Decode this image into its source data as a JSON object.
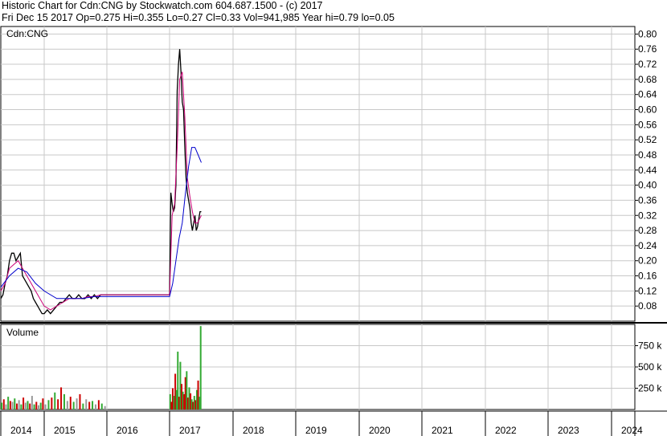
{
  "header": {
    "line1": "Historic Chart for Cdn:CNG by Stockwatch.com 604.687.1500 - (c) 2017",
    "line2": "Fri Dec 15 2017   Op=0.275   Hi=0.355   Lo=0.27   Cl=0.33   Vol=941,985   Year hi=0.79   lo=0.05"
  },
  "chart_data": [
    {
      "type": "line",
      "subtype": "ohlc-price",
      "label": "Cdn:CNG",
      "ylim": [
        0.04,
        0.82
      ],
      "y_ticks": [
        0.08,
        0.12,
        0.16,
        0.2,
        0.24,
        0.28,
        0.32,
        0.36,
        0.4,
        0.44,
        0.48,
        0.52,
        0.56,
        0.6,
        0.64,
        0.68,
        0.72,
        0.76,
        0.8
      ],
      "y_tick_labels": [
        "0.08",
        "0.12",
        "0.16",
        "0.20",
        "0.24",
        "0.28",
        "0.32",
        "0.36",
        "0.40",
        "0.44",
        "0.48",
        "0.52",
        "0.56",
        "0.60",
        "0.64",
        "0.68",
        "0.72",
        "0.76",
        "0.80"
      ],
      "x_years": [
        "2014",
        "2015",
        "2016",
        "2017",
        "2018",
        "2019",
        "2020",
        "2021",
        "2022",
        "2023",
        "2024"
      ],
      "grid": true,
      "series": [
        {
          "role": "price",
          "color": "#000000",
          "x": [
            2014.0,
            2014.05,
            2014.1,
            2014.15,
            2014.2,
            2014.25,
            2014.3,
            2014.35,
            2014.4,
            2014.45,
            2014.5,
            2014.55,
            2014.6,
            2014.65,
            2014.7,
            2014.75,
            2014.8,
            2014.85,
            2014.9,
            2014.95,
            2015.0,
            2015.05,
            2015.1,
            2015.15,
            2015.2,
            2015.25,
            2015.3,
            2015.35,
            2015.4,
            2015.45,
            2015.5,
            2015.55,
            2015.6,
            2015.65,
            2015.7,
            2015.75,
            2015.8,
            2015.85,
            2015.9,
            2015.95,
            2016.0,
            2017.0,
            2017.02,
            2017.04,
            2017.06,
            2017.08,
            2017.1,
            2017.12,
            2017.14,
            2017.16,
            2017.18,
            2017.2,
            2017.22,
            2017.24,
            2017.26,
            2017.28,
            2017.3,
            2017.32,
            2017.34,
            2017.36,
            2017.38,
            2017.4,
            2017.42,
            2017.44,
            2017.46,
            2017.48,
            2017.5
          ],
          "y": [
            0.1,
            0.11,
            0.14,
            0.16,
            0.2,
            0.22,
            0.22,
            0.2,
            0.21,
            0.22,
            0.16,
            0.15,
            0.14,
            0.13,
            0.12,
            0.1,
            0.09,
            0.08,
            0.07,
            0.06,
            0.06,
            0.07,
            0.06,
            0.07,
            0.08,
            0.09,
            0.09,
            0.1,
            0.11,
            0.1,
            0.1,
            0.11,
            0.1,
            0.1,
            0.11,
            0.1,
            0.11,
            0.1,
            0.11,
            0.11,
            0.11,
            0.11,
            0.38,
            0.35,
            0.33,
            0.34,
            0.4,
            0.65,
            0.72,
            0.76,
            0.7,
            0.62,
            0.6,
            0.5,
            0.42,
            0.38,
            0.36,
            0.34,
            0.3,
            0.28,
            0.3,
            0.32,
            0.28,
            0.29,
            0.31,
            0.33,
            0.33
          ]
        },
        {
          "role": "short-ma",
          "color": "#cc0077",
          "x": [
            2014.0,
            2014.1,
            2014.2,
            2014.3,
            2014.4,
            2014.5,
            2014.6,
            2014.7,
            2014.8,
            2014.9,
            2015.0,
            2015.1,
            2015.2,
            2015.3,
            2015.4,
            2015.5,
            2015.6,
            2015.7,
            2015.8,
            2015.9,
            2016.0,
            2017.0,
            2017.04,
            2017.08,
            2017.12,
            2017.16,
            2017.2,
            2017.24,
            2017.28,
            2017.32,
            2017.36,
            2017.4,
            2017.44,
            2017.5
          ],
          "y": [
            0.12,
            0.14,
            0.18,
            0.19,
            0.2,
            0.18,
            0.16,
            0.14,
            0.12,
            0.1,
            0.08,
            0.07,
            0.08,
            0.09,
            0.1,
            0.1,
            0.1,
            0.105,
            0.105,
            0.11,
            0.11,
            0.11,
            0.32,
            0.35,
            0.5,
            0.68,
            0.7,
            0.58,
            0.42,
            0.37,
            0.33,
            0.3,
            0.3,
            0.32
          ]
        },
        {
          "role": "long-ma",
          "color": "#0000cc",
          "x": [
            2014.0,
            2014.2,
            2014.4,
            2014.6,
            2014.8,
            2015.0,
            2015.2,
            2015.4,
            2015.6,
            2015.8,
            2016.0,
            2016.5,
            2017.0,
            2017.05,
            2017.1,
            2017.15,
            2017.2,
            2017.25,
            2017.3,
            2017.35,
            2017.4,
            2017.45,
            2017.5
          ],
          "y": [
            0.13,
            0.16,
            0.18,
            0.17,
            0.14,
            0.12,
            0.1,
            0.1,
            0.1,
            0.105,
            0.105,
            0.105,
            0.105,
            0.14,
            0.2,
            0.26,
            0.3,
            0.38,
            0.45,
            0.5,
            0.5,
            0.48,
            0.46
          ]
        }
      ]
    },
    {
      "type": "bar",
      "label": "Volume",
      "ylim": [
        0,
        1000000
      ],
      "y_ticks": [
        250000,
        500000,
        750000
      ],
      "y_tick_labels": [
        "250 k",
        "500 k",
        "750 k"
      ],
      "grid": true,
      "x": [
        2014.02,
        2014.07,
        2014.12,
        2014.17,
        2014.22,
        2014.27,
        2014.32,
        2014.37,
        2014.42,
        2014.47,
        2014.52,
        2014.57,
        2014.62,
        2014.67,
        2014.72,
        2014.77,
        2014.82,
        2014.87,
        2014.92,
        2014.97,
        2015.02,
        2015.07,
        2015.12,
        2015.17,
        2015.22,
        2015.27,
        2015.32,
        2015.37,
        2015.42,
        2015.47,
        2015.52,
        2015.57,
        2015.62,
        2015.67,
        2015.72,
        2015.77,
        2015.82,
        2015.87,
        2015.92,
        2015.97,
        2017.01,
        2017.03,
        2017.05,
        2017.07,
        2017.09,
        2017.11,
        2017.13,
        2017.15,
        2017.17,
        2017.19,
        2017.21,
        2017.23,
        2017.25,
        2017.27,
        2017.29,
        2017.31,
        2017.33,
        2017.35,
        2017.37,
        2017.39,
        2017.41,
        2017.43,
        2017.45,
        2017.47,
        2017.49
      ],
      "values": [
        80000,
        120000,
        60000,
        150000,
        100000,
        90000,
        130000,
        70000,
        110000,
        60000,
        140000,
        80000,
        100000,
        70000,
        160000,
        60000,
        90000,
        50000,
        80000,
        130000,
        60000,
        110000,
        140000,
        200000,
        120000,
        260000,
        180000,
        100000,
        150000,
        90000,
        130000,
        180000,
        70000,
        120000,
        90000,
        100000,
        60000,
        110000,
        70000,
        40000,
        180000,
        90000,
        250000,
        160000,
        420000,
        230000,
        680000,
        150000,
        560000,
        300000,
        210000,
        180000,
        380000,
        450000,
        140000,
        260000,
        190000,
        120000,
        90000,
        160000,
        110000,
        230000,
        340000,
        150000,
        980000
      ],
      "colors": [
        "#33aa33",
        "#cc0000",
        "#999999",
        "#33aa33",
        "#cc0000",
        "#999999",
        "#33aa33",
        "#cc0000",
        "#999999",
        "#33aa33",
        "#cc0000",
        "#999999",
        "#33aa33",
        "#cc0000",
        "#999999",
        "#33aa33",
        "#cc0000",
        "#999999",
        "#33aa33",
        "#cc0000",
        "#999999",
        "#33aa33",
        "#cc0000",
        "#33aa33",
        "#cc0000",
        "#cc0000",
        "#33aa33",
        "#999999",
        "#cc0000",
        "#33aa33",
        "#999999",
        "#cc0000",
        "#33aa33",
        "#999999",
        "#cc0000",
        "#33aa33",
        "#999999",
        "#cc0000",
        "#33aa33",
        "#999999",
        "#33aa33",
        "#cc0000",
        "#cc0000",
        "#33aa33",
        "#cc0000",
        "#33aa33",
        "#33aa33",
        "#cc0000",
        "#33aa33",
        "#cc0000",
        "#33aa33",
        "#cc0000",
        "#cc0000",
        "#33aa33",
        "#cc0000",
        "#33aa33",
        "#cc0000",
        "#33aa33",
        "#cc0000",
        "#33aa33",
        "#cc0000",
        "#33aa33",
        "#cc0000",
        "#33aa33",
        "#33aa33"
      ]
    }
  ]
}
